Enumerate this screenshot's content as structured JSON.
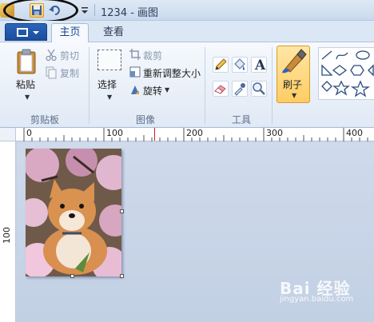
{
  "window": {
    "title": "1234 - 画图"
  },
  "tabs": {
    "home": "主页",
    "view": "查看"
  },
  "clipboard": {
    "paste": "粘贴",
    "cut": "剪切",
    "copy": "复制",
    "group": "剪贴板"
  },
  "image": {
    "select": "选择",
    "crop": "裁剪",
    "resize": "重新调整大小",
    "rotate": "旋转",
    "group": "图像"
  },
  "tools": {
    "text_tool_glyph": "A",
    "group": "工具"
  },
  "brushes": {
    "label": "刷子"
  },
  "ruler": {
    "top_ticks": [
      "0",
      "100",
      "200",
      "300",
      "400"
    ],
    "left_ticks": [
      "100"
    ]
  },
  "watermark": {
    "brand": "Bai 经验",
    "url": "jingyan.baidu.com"
  },
  "colors": {
    "accent_orange": "#ffcc63",
    "ribbon_bg": "#f6f9fd",
    "canvas_bg": "#c6d3e6"
  }
}
